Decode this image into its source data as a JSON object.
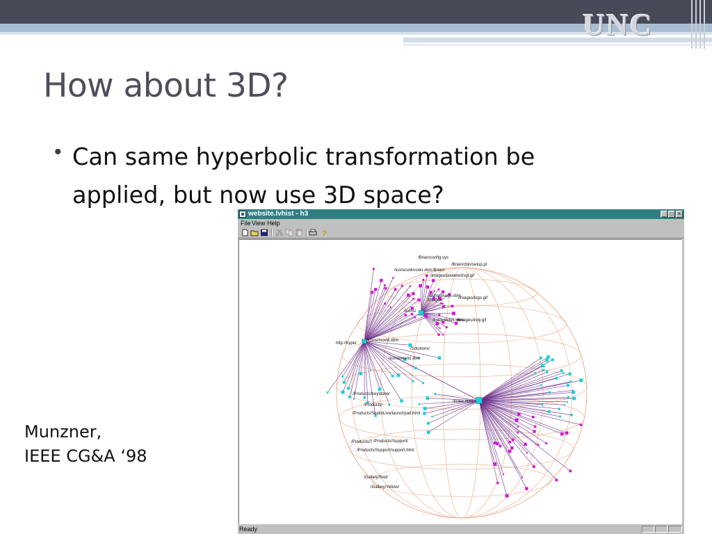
{
  "slide": {
    "title": "How about 3D?",
    "bullet": "Can same hyperbolic transformation be applied, but now use 3D space?",
    "citation_line1": "Munzner,",
    "citation_line2": "IEEE CG&A ‘98",
    "logo_text": "UNC"
  },
  "window": {
    "title": "website.lvhist - h3",
    "controls": {
      "minimize": "_",
      "maximize": "□",
      "close": "×"
    },
    "menu": [
      "File",
      "View",
      "Help"
    ],
    "toolbar": [
      "new-file-icon",
      "open-folder-icon",
      "save-icon",
      "cut-icon",
      "copy-icon",
      "paste-icon",
      "print-icon",
      "help-icon"
    ],
    "status": "Ready",
    "labels": [
      "/Brian/config.sys",
      "/Brian/cbin/setup.pl",
      "/icons/unknown.xbm",
      "/Brian/",
      "/images/powered/sgi.gif",
      "/icons/image.xbm",
      "/images/",
      "/images/logo.gif",
      "/icons/",
      "/icons/index.xbm",
      "/images/indy.gif",
      "/icons/movie.xbm",
      "http://hyper",
      "/Solutions/",
      "/icons/menu.xbm",
      "/Products/Keystone/",
      "/Products/",
      "/Products/StudioLive/launchpad.html",
      "/index.html",
      "/Products/T",
      "/Products/Support/",
      "/Products/Support/support.html",
      "/Gallery/Red/",
      "/Gallery/Yellow/"
    ]
  },
  "colors": {
    "header_dark": "#474a57",
    "header_stripe": "#a9bdd2",
    "titlebar": "#2f7f82",
    "globe": "#e8a888",
    "edge": "#6b2f8a",
    "node_magenta": "#d21ad2",
    "node_cyan": "#18d0d8"
  }
}
